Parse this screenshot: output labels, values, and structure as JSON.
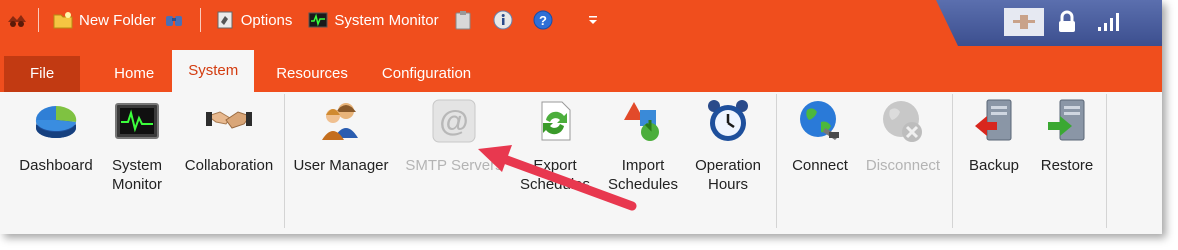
{
  "quick_access": {
    "new_folder_label": "New Folder",
    "options_label": "Options",
    "system_monitor_label": "System Monitor",
    "icons": [
      "app-icon",
      "new-folder-icon",
      "find-icon",
      "options-icon",
      "system-monitor-icon",
      "clipboard-icon",
      "info-icon",
      "help-icon",
      "dropdown-arrow-icon"
    ]
  },
  "status_icons": [
    "plug-icon",
    "lock-icon",
    "signal-icon"
  ],
  "tabs": [
    {
      "label": "File"
    },
    {
      "label": "Home"
    },
    {
      "label": "System",
      "active": true
    },
    {
      "label": "Resources"
    },
    {
      "label": "Configuration"
    }
  ],
  "ribbon": {
    "buttons": [
      {
        "line1": "Dashboard",
        "line2": "",
        "icon": "dashboard-icon",
        "enabled": true
      },
      {
        "line1": "System",
        "line2": "Monitor",
        "icon": "system-monitor-icon",
        "enabled": true
      },
      {
        "line1": "Collaboration",
        "line2": "",
        "icon": "handshake-icon",
        "enabled": true
      },
      {
        "line1": "User Manager",
        "line2": "",
        "icon": "users-icon",
        "enabled": true
      },
      {
        "line1": "SMTP Servers",
        "line2": "",
        "icon": "at-sign-icon",
        "enabled": false
      },
      {
        "line1": "Export",
        "line2": "Schedules",
        "icon": "export-icon",
        "enabled": true
      },
      {
        "line1": "Import",
        "line2": "Schedules",
        "icon": "import-icon",
        "enabled": true
      },
      {
        "line1": "Operation",
        "line2": "Hours",
        "icon": "clock-icon",
        "enabled": true
      },
      {
        "line1": "Connect",
        "line2": "",
        "icon": "globe-connect-icon",
        "enabled": true
      },
      {
        "line1": "Disconnect",
        "line2": "",
        "icon": "globe-disconnect-icon",
        "enabled": false
      },
      {
        "line1": "Backup",
        "line2": "",
        "icon": "backup-icon",
        "enabled": true
      },
      {
        "line1": "Restore",
        "line2": "",
        "icon": "restore-icon",
        "enabled": true
      }
    ]
  },
  "annotation": {
    "arrow_color": "#e8384f"
  },
  "colors": {
    "accent": "#f04e1d",
    "file_tab": "#c23a12",
    "active_tab_text": "#d33c10",
    "status_area": "#3c4f8f",
    "disabled_text": "#b4b4b4"
  }
}
